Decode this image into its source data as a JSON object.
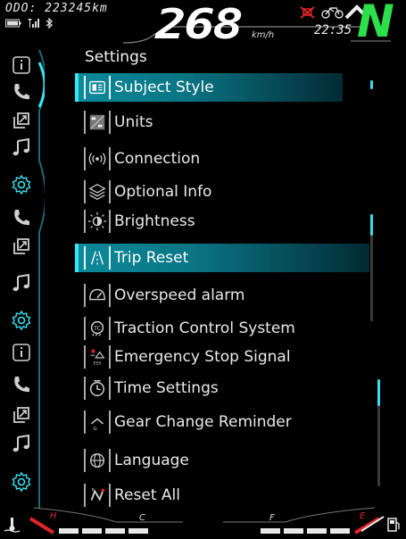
{
  "status": {
    "odo": "ODO: 223245km",
    "speed": "268",
    "speed_unit": "km/h",
    "clock": "22:35",
    "gear": "N"
  },
  "settings": {
    "title": "Settings",
    "items": [
      {
        "label": "Subject Style",
        "icon": "subject-style-icon",
        "selected": true
      },
      {
        "label": "Units",
        "icon": "units-icon",
        "selected": false
      },
      {
        "label": "Connection",
        "icon": "connection-icon",
        "selected": false
      },
      {
        "label": "Optional Info",
        "icon": "optional-info-icon",
        "selected": false
      },
      {
        "label": "Brightness",
        "icon": "brightness-icon",
        "selected": false
      },
      {
        "label": "Trip Reset",
        "icon": "trip-reset-icon",
        "selected": true
      },
      {
        "label": "Overspeed alarm",
        "icon": "overspeed-alarm-icon",
        "selected": false
      },
      {
        "label": "Traction Control System",
        "icon": "traction-control-icon",
        "selected": false
      },
      {
        "label": "Emergency Stop Signal",
        "icon": "emergency-stop-icon",
        "selected": false
      },
      {
        "label": "Time Settings",
        "icon": "time-settings-icon",
        "selected": false
      },
      {
        "label": "Gear Change Reminder",
        "icon": "gear-change-icon",
        "selected": false
      },
      {
        "label": "Language",
        "icon": "language-icon",
        "selected": false
      },
      {
        "label": "Reset All",
        "icon": "reset-all-icon",
        "selected": false
      }
    ]
  },
  "sidebar": {
    "items": [
      "info-icon",
      "phone-icon",
      "navigation-icon",
      "music-icon",
      "settings-icon",
      "phone-icon",
      "navigation-icon",
      "music-icon",
      "settings-icon",
      "info-icon",
      "phone-icon",
      "navigation-icon",
      "music-icon",
      "settings-icon"
    ]
  },
  "gauges": {
    "temp_left": "H",
    "temp_right": "C",
    "fuel_left": "F",
    "fuel_right": "E"
  },
  "colors": {
    "accent": "#35e6f5",
    "selected_bg": "#0a7d8c",
    "gear": "#2be04a",
    "warning": "#e0242a"
  }
}
